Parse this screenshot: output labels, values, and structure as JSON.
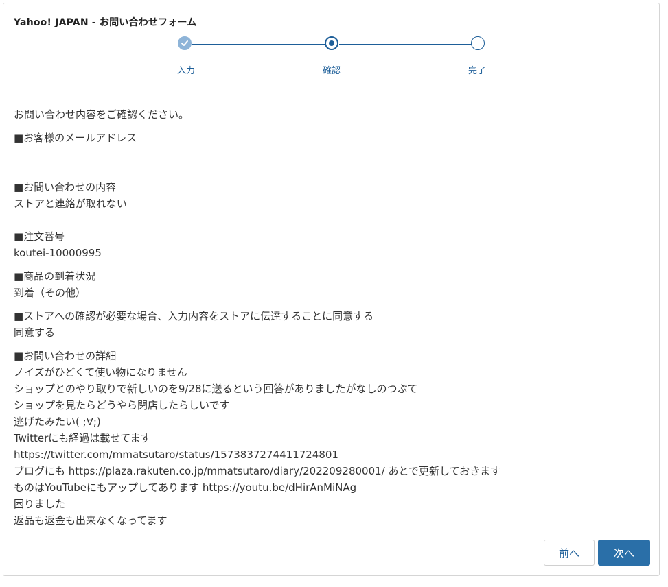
{
  "header": {
    "title": "Yahoo! JAPAN - お問い合わせフォーム"
  },
  "stepper": {
    "steps": [
      {
        "label": "入力",
        "state": "done"
      },
      {
        "label": "確認",
        "state": "current"
      },
      {
        "label": "完了",
        "state": "todo"
      }
    ],
    "colors": {
      "accent": "#1e5f99",
      "done": "#8eb4d8"
    }
  },
  "main": {
    "intro": "お問い合わせ内容をご確認ください。",
    "sections": [
      {
        "heading": "■お客様のメールアドレス",
        "value": ""
      },
      {
        "heading": "■お問い合わせの内容",
        "value": "ストアと連絡が取れない"
      },
      {
        "heading": "■注文番号",
        "value": "koutei-10000995"
      },
      {
        "heading": "■商品の到着状況",
        "value": "到着（その他）"
      },
      {
        "heading": "■ストアへの確認が必要な場合、入力内容をストアに伝達することに同意する",
        "value": "同意する"
      },
      {
        "heading": "■お問い合わせの詳細",
        "value": "ノイズがひどくて使い物になりません\nショップとのやり取りで新しいのを9/28に送るという回答がありましたがなしのつぶて\nショップを見たらどうやら閉店したらしいです\n逃げたみたい( ;∀;)\nTwitterにも経過は載せてます\nhttps://twitter.com/mmatsutaro/status/1573837274411724801\nブログにも https://plaza.rakuten.co.jp/mmatsutaro/diary/202209280001/ あとで更新しておきます\nものはYouTubeにもアップしてあります https://youtu.be/dHirAnMiNAg\n困りました\n返品も返金も出来なくなってます"
      }
    ]
  },
  "footer": {
    "back_label": "前へ",
    "next_label": "次へ",
    "colors": {
      "primary": "#2a6fa8"
    }
  }
}
